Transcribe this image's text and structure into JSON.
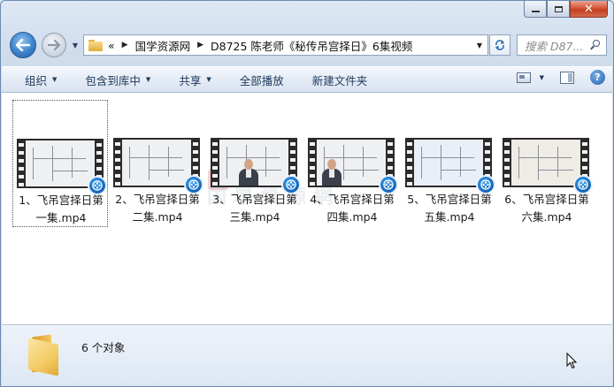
{
  "window": {
    "address": {
      "prefix": "«",
      "crumbs": [
        "国学资源网",
        "D8725 陈老师《秘传吊宫择日》6集视频"
      ]
    },
    "search_placeholder": "搜索 D87...",
    "icons": [
      "back-arrow-icon",
      "forward-arrow-icon",
      "refresh-icon",
      "search-icon",
      "folder-icon"
    ]
  },
  "toolbar": {
    "organize": "组织",
    "include_in_library": "包含到库中",
    "share": "共享",
    "play_all": "全部播放",
    "new_folder": "新建文件夹"
  },
  "files": [
    {
      "line1": "1、飞吊宫择日第",
      "line2": "一集.mp4",
      "style": "chart",
      "selected": true
    },
    {
      "line1": "2、飞吊宫择日第",
      "line2": "二集.mp4",
      "style": "chart",
      "selected": false
    },
    {
      "line1": "3、飞吊宫择日第",
      "line2": "三集.mp4",
      "style": "person",
      "selected": false
    },
    {
      "line1": "4、飞吊宫择日第",
      "line2": "四集.mp4",
      "style": "person",
      "selected": false
    },
    {
      "line1": "5、飞吊宫择日第",
      "line2": "五集.mp4",
      "style": "blue",
      "selected": false
    },
    {
      "line1": "6、飞吊宫择日第",
      "line2": "六集.mp4",
      "style": "warm",
      "selected": false
    }
  ],
  "details": {
    "count": "6 个对象"
  },
  "watermark": "国學資源網",
  "colors": {
    "accent": "#1e395b",
    "badge": "#1465b8"
  }
}
